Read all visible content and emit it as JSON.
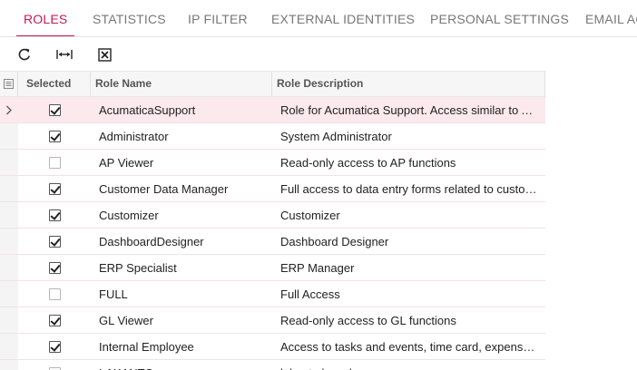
{
  "tabs": [
    {
      "label": "ROLES",
      "active": true
    },
    {
      "label": "STATISTICS",
      "active": false
    },
    {
      "label": "IP FILTER",
      "active": false
    },
    {
      "label": "EXTERNAL IDENTITIES",
      "active": false
    },
    {
      "label": "PERSONAL SETTINGS",
      "active": false
    },
    {
      "label": "EMAIL AC",
      "active": false
    }
  ],
  "toolbar": {
    "icons": [
      "refresh-icon",
      "fit-to-screen-icon",
      "export-to-excel-icon"
    ]
  },
  "colors": {
    "accent": "#c2185b",
    "current_row": "#fbe9ee"
  },
  "grid": {
    "columns": {
      "selected": "Selected",
      "role_name": "Role Name",
      "role_description": "Role Description"
    },
    "rows": [
      {
        "selected": true,
        "name": "AcumaticaSupport",
        "description": "Role for Acumatica Support. Access similar to Administrator",
        "current": true
      },
      {
        "selected": true,
        "name": "Administrator",
        "description": "System Administrator"
      },
      {
        "selected": false,
        "name": "AP Viewer",
        "description": "Read-only access to AP functions"
      },
      {
        "selected": true,
        "name": "Customer Data Manager",
        "description": "Full access to data entry forms related to customers"
      },
      {
        "selected": true,
        "name": "Customizer",
        "description": "Customizer"
      },
      {
        "selected": true,
        "name": "DashboardDesigner",
        "description": "Dashboard Designer"
      },
      {
        "selected": true,
        "name": "ERP Specialist",
        "description": "ERP Manager"
      },
      {
        "selected": false,
        "name": "FULL",
        "description": "Full Access"
      },
      {
        "selected": true,
        "name": "GL Viewer",
        "description": "Read-only access to GL functions"
      },
      {
        "selected": true,
        "name": "Internal Employee",
        "description": "Access to tasks and events, time card, expense claims"
      },
      {
        "selected": false,
        "name": "LAKANTO",
        "description": "lakanto brand"
      }
    ]
  }
}
